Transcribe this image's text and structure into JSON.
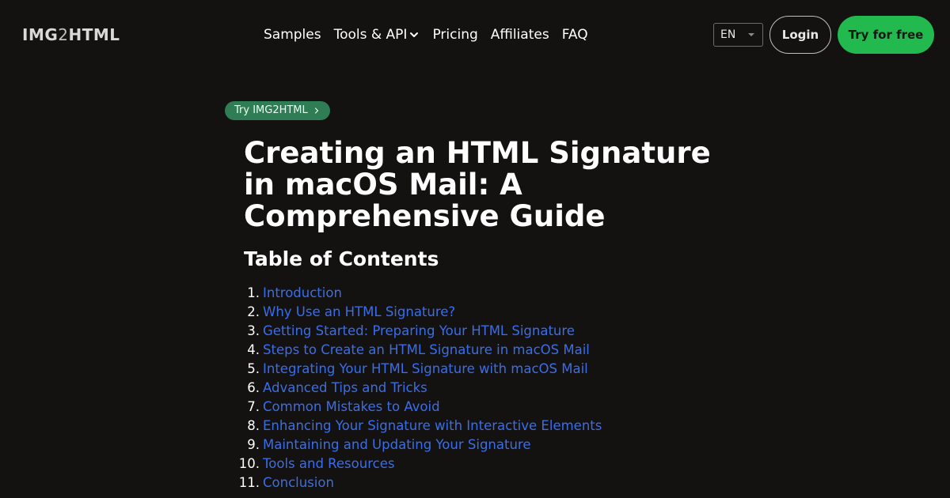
{
  "header": {
    "logo_prefix": "IMG",
    "logo_two": "2",
    "logo_suffix": "HTML",
    "nav": [
      {
        "label": "Samples"
      },
      {
        "label": "Tools & API",
        "has_dropdown": true
      },
      {
        "label": "Pricing"
      },
      {
        "label": "Affiliates"
      },
      {
        "label": "FAQ"
      }
    ],
    "language": "EN",
    "login_label": "Login",
    "cta_label": "Try for free",
    "cta_color": "#22b94f"
  },
  "article": {
    "badge_label": "Try IMG2HTML",
    "badge_color": "#2f7d55",
    "title": "Creating an HTML Signature in macOS Mail: A Comprehensive Guide",
    "toc_heading": "Table of Contents",
    "link_color": "#3a6ee8",
    "toc": [
      {
        "num": "1.",
        "label": "Introduction"
      },
      {
        "num": "2.",
        "label": "Why Use an HTML Signature?"
      },
      {
        "num": "3.",
        "label": "Getting Started: Preparing Your HTML Signature"
      },
      {
        "num": "4.",
        "label": "Steps to Create an HTML Signature in macOS Mail"
      },
      {
        "num": "5.",
        "label": "Integrating Your HTML Signature with macOS Mail"
      },
      {
        "num": "6.",
        "label": "Advanced Tips and Tricks"
      },
      {
        "num": "7.",
        "label": "Common Mistakes to Avoid"
      },
      {
        "num": "8.",
        "label": "Enhancing Your Signature with Interactive Elements"
      },
      {
        "num": "9.",
        "label": "Maintaining and Updating Your Signature"
      },
      {
        "num": "10.",
        "label": "Tools and Resources"
      },
      {
        "num": "11.",
        "label": "Conclusion"
      }
    ]
  }
}
